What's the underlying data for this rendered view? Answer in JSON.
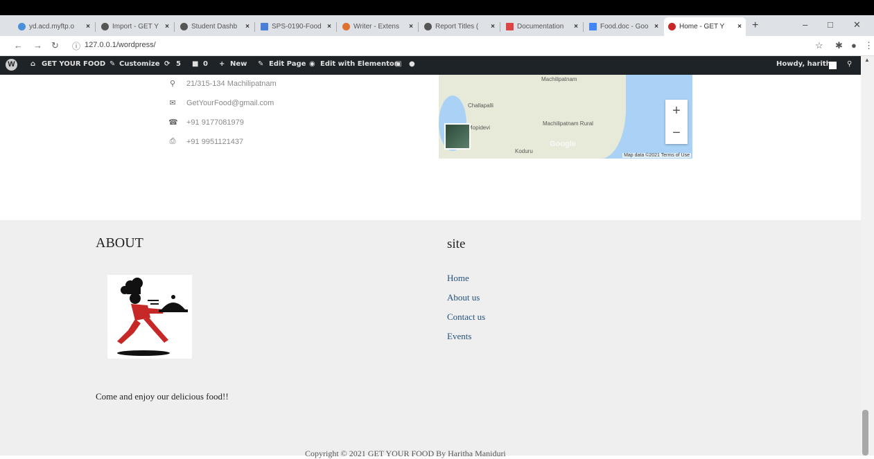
{
  "browser": {
    "tabs": [
      {
        "label": "yd.acd.myftp.o",
        "active": false
      },
      {
        "label": "Import - GET Y",
        "active": false
      },
      {
        "label": "Student Dashb",
        "active": false
      },
      {
        "label": "SPS-0190-Food",
        "active": false
      },
      {
        "label": "Writer - Extens",
        "active": false
      },
      {
        "label": "Report Titles (",
        "active": false
      },
      {
        "label": "Documentation",
        "active": false
      },
      {
        "label": "Food.doc - Goo",
        "active": false
      },
      {
        "label": "Home - GET Y",
        "active": true
      }
    ],
    "new_tab": "+",
    "url": "127.0.0.1/wordpress/"
  },
  "adminbar": {
    "site_name": "GET YOUR FOOD",
    "customize": "Customize",
    "updates": "5",
    "comments": "0",
    "new": "New",
    "edit_page": "Edit Page",
    "elementor": "Edit with Elementor",
    "howdy": "Howdy, haritha"
  },
  "contact": {
    "address": "21/315-134 Machilipatnam",
    "email": "GetYourFood@gmail.com",
    "phone1": "+91 9177081979",
    "phone2": "+91 9951121437"
  },
  "map": {
    "labels": [
      "Machilipatnam",
      "Challapalli",
      "Machilipatnam Rural",
      "Mopidevi",
      "Koduru",
      "Google"
    ],
    "zoom_in": "+",
    "zoom_out": "−",
    "footer": "Map data ©2021   Terms of Use"
  },
  "footer": {
    "about_heading": "ABOUT",
    "site_heading": "site",
    "links": [
      "Home",
      "About us",
      "Contact us",
      "Events"
    ],
    "tagline": "Come and enjoy our delicious food!!",
    "copyright": "Copyright © 2021 GET YOUR FOOD By Haritha Maniduri"
  },
  "colors": {
    "adminbar": "#1d2327",
    "footer_bg": "#efefef",
    "link": "#23527c",
    "logo_red": "#c62828"
  }
}
